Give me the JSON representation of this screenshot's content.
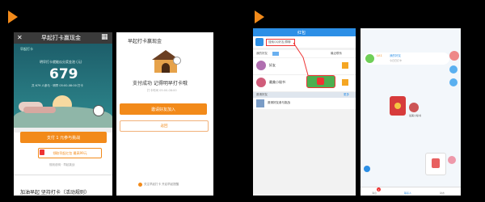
{
  "colors": {
    "orange": "#f28a1a",
    "teal": "#1f6f7a",
    "qq_blue": "#2c8fe6",
    "bg": "#000000"
  },
  "screen1": {
    "close_glyph": "✕",
    "title": "早起打卡赢现金",
    "grid_glyph": "▦",
    "brand": "早起打卡",
    "line1": "明早打卡就能瓜分奖金池 (元)",
    "amount": "679",
    "line2": "共 679 人参与 · 明早 05:00-08:00 打卡",
    "pay_button": "支付 1 元参与挑战",
    "redpacket_button": "领取早起红包 最高99元",
    "footer": "规则说明 · 早起挑战",
    "bottom_text": "加油早起 坚持打卡（活动规则）"
  },
  "screen2": {
    "title": "早起打卡赢现金",
    "success": "支付成功 记得明早打卡哦",
    "subtitle": "打卡时间 05:00-08:00",
    "invite_button": "邀请好友加入",
    "back_button": "返回",
    "footer": "关注早起打卡 开启早起提醒"
  },
  "screen3": {
    "header": "红包",
    "search": "搜索QQ好友/群聊",
    "section": "我的好友",
    "section_right": "最近联系",
    "contact1": "好友",
    "contact2": "最美小秘书",
    "bar": "邀请好友",
    "bar_right": "更多",
    "invite_item": "邀请好友参与挑战"
  },
  "screen4": {
    "title": "我的好友",
    "subtitle": "今日已打卡",
    "badge": "LV.1",
    "name": "最美小秘书",
    "tab1": "消息",
    "tab2": "联系人",
    "tab3": "动态",
    "red_badge": "2"
  }
}
